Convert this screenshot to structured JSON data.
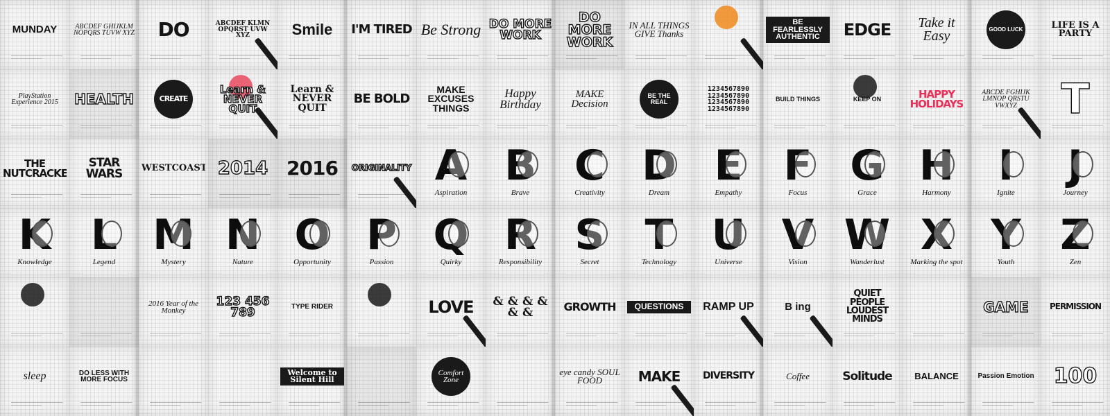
{
  "mosaic": {
    "rows": [
      [
        {
          "text": "MUNDAY",
          "style": "s-sans",
          "size": 15
        },
        {
          "text": "ABCDEF GHIJKLM NOPQRS TUVW XYZ",
          "style": "s-script",
          "size": 10
        },
        {
          "text": "DO",
          "style": "s-block",
          "size": 28
        },
        {
          "text": "ABCDEF KLMN OPQRST UVW XYZ",
          "style": "s-serif",
          "size": 9,
          "pen": true
        },
        {
          "text": "Smile",
          "style": "s-sans",
          "size": 22
        },
        {
          "text": "I'M TIRED",
          "style": "s-block",
          "size": 18
        },
        {
          "text": "Be Strong",
          "style": "s-script",
          "size": 22
        },
        {
          "text": "DO MORE WORK",
          "style": "s-outline",
          "size": 17
        },
        {
          "text": "DO MORE WORK",
          "style": "s-outline",
          "size": 19,
          "dark": true
        },
        {
          "text": "IN ALL THINGS GIVE Thanks",
          "style": "s-script",
          "size": 13
        },
        {
          "text": "",
          "style": "s-sans",
          "size": 12,
          "accent": "#f08a1c",
          "pen": true
        },
        {
          "text": "BE FEARLESSLY AUTHENTIC",
          "style": "s-sans",
          "size": 11,
          "boxed": true
        },
        {
          "text": "EDGE",
          "style": "s-block",
          "size": 24
        },
        {
          "text": "Take it Easy",
          "style": "s-script",
          "size": 20
        },
        {
          "text": "GOOD LUCK",
          "style": "s-sans",
          "size": 8,
          "badge": "8"
        },
        {
          "text": "LIFE IS A PARTY",
          "style": "s-serif",
          "size": 13
        }
      ],
      [
        {
          "text": "PlayStation Experience 2015",
          "style": "s-script",
          "size": 10
        },
        {
          "text": "HEALTH",
          "style": "s-outline",
          "size": 20,
          "dark": true
        },
        {
          "text": "CREATE",
          "style": "s-block",
          "size": 13,
          "badge": "CREATE"
        },
        {
          "text": "Learn & NEVER QUIT",
          "style": "s-outline",
          "size": 15,
          "accent": "#e84a5f",
          "pen": true
        },
        {
          "text": "Learn & NEVER QUIT",
          "style": "s-serif",
          "size": 14
        },
        {
          "text": "BE BOLD",
          "style": "s-block",
          "size": 18
        },
        {
          "text": "MAKE EXCUSES THINGS",
          "style": "s-sans",
          "size": 14
        },
        {
          "text": "Happy Birthday",
          "style": "s-script",
          "size": 17
        },
        {
          "text": "MAKE Decision",
          "style": "s-script",
          "size": 15
        },
        {
          "text": "BE THE REAL",
          "style": "s-sans",
          "size": 9,
          "badge": "BE THE REAL"
        },
        {
          "text": "1234567890 1234567890 1234567890 1234567890",
          "style": "s-mono",
          "size": 10
        },
        {
          "text": "BUILD THINGS",
          "style": "s-sans",
          "size": 9
        },
        {
          "text": "KEEP ON",
          "style": "s-sans",
          "size": 9,
          "accent": "#1a1a1a"
        },
        {
          "text": "HAPPY HOLIDAYS",
          "style": "s-block",
          "size": 15,
          "color": "#e8305a"
        },
        {
          "text": "ABCDE FGHIJK LMNOP QRSTU VWXYZ",
          "style": "s-script",
          "size": 10,
          "pen": true
        },
        {
          "text": "T",
          "style": "s-outline",
          "size": 60
        }
      ],
      [
        {
          "text": "THE NUTCRACKER",
          "style": "s-block",
          "size": 15
        },
        {
          "text": "STAR WARS",
          "style": "s-block",
          "size": 17
        },
        {
          "text": "WESTCOAST",
          "style": "s-serif",
          "size": 13
        },
        {
          "text": "2014",
          "style": "s-outline",
          "size": 26,
          "dark": true
        },
        {
          "text": "2016",
          "style": "s-block",
          "size": 28,
          "dark": true
        },
        {
          "text": "ORIGINALITY",
          "style": "s-outline",
          "size": 12,
          "pen": true
        },
        {
          "letter": "A",
          "word": "Aspiration"
        },
        {
          "letter": "B",
          "word": "Brave"
        },
        {
          "letter": "C",
          "word": "Creativity"
        },
        {
          "letter": "D",
          "word": "Dream"
        },
        {
          "letter": "E",
          "word": "Empathy"
        },
        {
          "letter": "F",
          "word": "Focus"
        },
        {
          "letter": "G",
          "word": "Grace"
        },
        {
          "letter": "H",
          "word": "Harmony"
        },
        {
          "letter": "I",
          "word": "Ignite"
        },
        {
          "letter": "J",
          "word": "Journey"
        }
      ],
      [
        {
          "letter": "K",
          "word": "Knowledge"
        },
        {
          "letter": "L",
          "word": "Legend"
        },
        {
          "letter": "M",
          "word": "Mystery"
        },
        {
          "letter": "N",
          "word": "Nature"
        },
        {
          "letter": "O",
          "word": "Opportunity"
        },
        {
          "letter": "P",
          "word": "Passion"
        },
        {
          "letter": "Q",
          "word": "Quirky"
        },
        {
          "letter": "R",
          "word": "Responsibility"
        },
        {
          "letter": "S",
          "word": "Secret"
        },
        {
          "letter": "T",
          "word": "Technology"
        },
        {
          "letter": "U",
          "word": "Universe"
        },
        {
          "letter": "V",
          "word": "Vision"
        },
        {
          "letter": "W",
          "word": "Wanderlust"
        },
        {
          "letter": "X",
          "word": "Marking the spot"
        },
        {
          "letter": "Y",
          "word": "Youth"
        },
        {
          "letter": "Z",
          "word": "Zen"
        }
      ],
      [
        {
          "text": "",
          "style": "s-block",
          "size": 12,
          "accent": "#1a1a1a"
        },
        {
          "text": "",
          "style": "s-block",
          "size": 12,
          "dark": true
        },
        {
          "text": "2016 Year of the Monkey",
          "style": "s-script",
          "size": 11
        },
        {
          "text": "123 456 789",
          "style": "s-outline",
          "size": 17
        },
        {
          "text": "TYPE RIDER",
          "style": "s-sans",
          "size": 10
        },
        {
          "text": "",
          "style": "s-block",
          "size": 12,
          "accent": "#1a1a1a"
        },
        {
          "text": "LOVE",
          "style": "s-block",
          "size": 24,
          "pen": true
        },
        {
          "text": "& & & & & &",
          "style": "s-serif",
          "size": 17
        },
        {
          "text": "GROWTH",
          "style": "s-block",
          "size": 16
        },
        {
          "text": "QUESTIONS",
          "style": "s-sans",
          "size": 12,
          "boxed": true
        },
        {
          "text": "RAMP UP",
          "style": "s-sans",
          "size": 16,
          "pen": true
        },
        {
          "text": "B ing",
          "style": "s-sans",
          "size": 15,
          "pen": true
        },
        {
          "text": "QUIET PEOPLE LOUDEST MINDS",
          "style": "s-block",
          "size": 13
        },
        {
          "text": "",
          "style": "s-sans",
          "size": 12
        },
        {
          "text": "GAME",
          "style": "s-outline",
          "size": 20,
          "dark": true
        },
        {
          "text": "PERMISSION",
          "style": "s-block",
          "size": 12
        }
      ],
      [
        {
          "text": "sleep",
          "style": "s-script",
          "size": 16
        },
        {
          "text": "DO LESS WITH MORE FOCUS",
          "style": "s-sans",
          "size": 10
        },
        {
          "text": "",
          "style": "s-script",
          "size": 12
        },
        {
          "text": "",
          "style": "s-script",
          "size": 12
        },
        {
          "text": "Welcome to Silent Hill",
          "style": "s-serif",
          "size": 11,
          "boxed": true
        },
        {
          "text": "",
          "style": "s-script",
          "size": 12,
          "dark": true
        },
        {
          "text": "Comfort Zone",
          "style": "s-script",
          "size": 11,
          "badge": "Comfort Zone"
        },
        {
          "text": "",
          "style": "s-mono",
          "size": 12
        },
        {
          "text": "eye candy SOUL FOOD",
          "style": "s-script",
          "size": 13
        },
        {
          "text": "MAKE",
          "style": "s-block",
          "size": 20,
          "pen": true
        },
        {
          "text": "DIVERSITY",
          "style": "s-block",
          "size": 14
        },
        {
          "text": "Coffee",
          "style": "s-script",
          "size": 13
        },
        {
          "text": "Solitude",
          "style": "s-block",
          "size": 17
        },
        {
          "text": "BALANCE",
          "style": "s-sans",
          "size": 13
        },
        {
          "text": "Passion Emotion",
          "style": "s-sans",
          "size": 10
        },
        {
          "text": "100",
          "style": "s-outline",
          "size": 30
        }
      ]
    ]
  }
}
